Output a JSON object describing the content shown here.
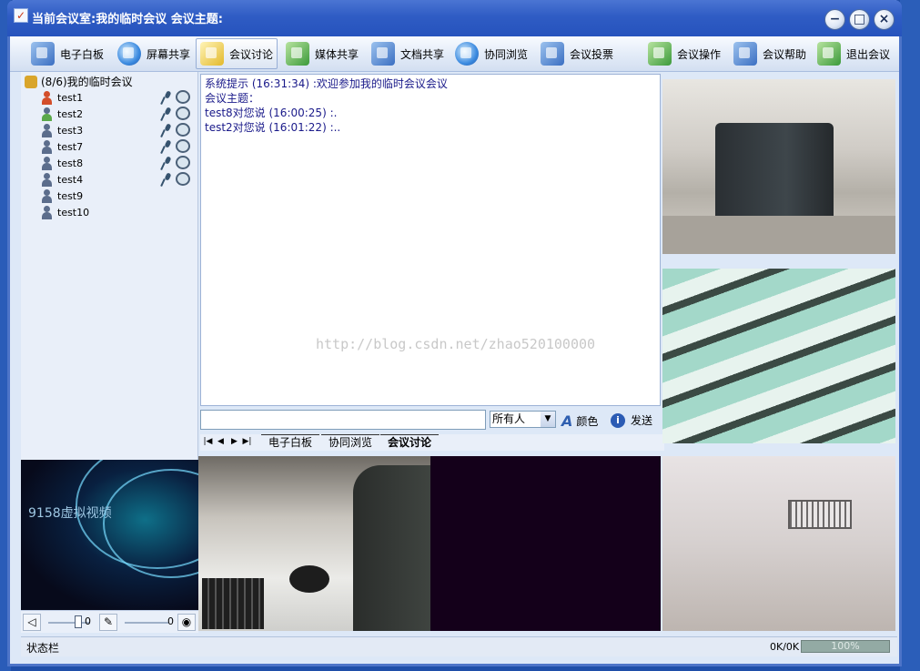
{
  "window": {
    "title": "当前会议室:我的临时会议 会议主题:",
    "buttons": {
      "minimize": "−",
      "maximize": "□",
      "close": "×"
    }
  },
  "toolbar": {
    "items": [
      {
        "label": "电子白板",
        "icon": "whiteboard-icon"
      },
      {
        "label": "屏幕共享",
        "icon": "screen-share-icon"
      },
      {
        "label": "会议讨论",
        "icon": "discussion-icon",
        "active": true
      },
      {
        "label": "媒体共享",
        "icon": "media-share-icon"
      },
      {
        "label": "文档共享",
        "icon": "document-share-icon"
      },
      {
        "label": "协同浏览",
        "icon": "browser-icon"
      },
      {
        "label": "会议投票",
        "icon": "vote-icon"
      },
      {
        "label": "会议操作",
        "icon": "meeting-ops-icon"
      },
      {
        "label": "会议帮助",
        "icon": "help-icon"
      },
      {
        "label": "退出会议",
        "icon": "exit-icon"
      }
    ]
  },
  "sidebar": {
    "meeting": "(8/6)我的临时会议",
    "users": [
      {
        "name": "test1",
        "status": "red",
        "mic": true,
        "cam": true
      },
      {
        "name": "test2",
        "status": "green",
        "mic": true,
        "cam": true
      },
      {
        "name": "test3",
        "status": "gray",
        "mic": true,
        "cam": true
      },
      {
        "name": "test7",
        "status": "gray",
        "mic": true,
        "cam": true
      },
      {
        "name": "test8",
        "status": "gray",
        "mic": true,
        "cam": true
      },
      {
        "name": "test4",
        "status": "gray",
        "mic": true,
        "cam": true
      },
      {
        "name": "test9",
        "status": "gray",
        "mic": false,
        "cam": false
      },
      {
        "name": "test10",
        "status": "gray",
        "mic": false,
        "cam": false
      }
    ]
  },
  "chat": {
    "lines": [
      "系统提示 (16:31:34) :欢迎参加我的临时会议会议",
      "会议主题：",
      "test8对您说 (16:00:25) :.",
      "test2对您说 (16:01:22) :.."
    ],
    "watermark": "http://blog.csdn.net/zhao520100000",
    "input_value": "",
    "recipient": "所有人",
    "color_label": "颜色",
    "send_label": "发送"
  },
  "tabs": {
    "nav": [
      "|◀",
      "◀",
      "▶",
      "▶|"
    ],
    "items": [
      {
        "label": "电子白板"
      },
      {
        "label": "协同浏览"
      },
      {
        "label": "会议讨论",
        "active": true
      }
    ]
  },
  "local_video": {
    "label": "9158虚拟视频"
  },
  "audio": {
    "speaker_volume": "0",
    "mic_volume": "0"
  },
  "status": {
    "text": "状态栏",
    "traffic": "0K/0K",
    "progress_label": "100%",
    "progress_fraction": 1.0
  }
}
